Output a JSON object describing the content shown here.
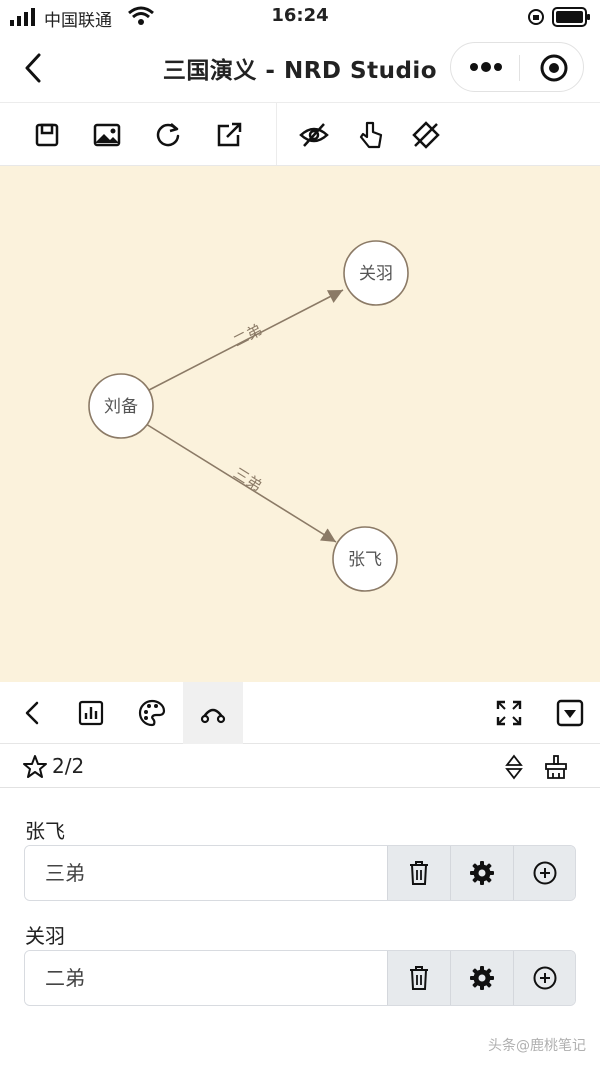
{
  "status_bar": {
    "carrier": "中国联通",
    "time": "16:24"
  },
  "nav": {
    "title": "三国演义 - NRD Studio"
  },
  "toolbar": {
    "left_icons": [
      "save-icon",
      "image-icon",
      "refresh-icon",
      "share-icon"
    ],
    "right_icons": [
      "hide-icon",
      "pointer-icon",
      "crosshair-icon"
    ]
  },
  "graph": {
    "background": "#fbf2dc",
    "nodes": [
      {
        "id": "liubei",
        "label": "刘备"
      },
      {
        "id": "guanyu",
        "label": "关羽"
      },
      {
        "id": "zhangfei",
        "label": "张飞"
      }
    ],
    "edges": [
      {
        "from": "liubei",
        "to": "guanyu",
        "label": "二弟"
      },
      {
        "from": "liubei",
        "to": "zhangfei",
        "label": "三弟"
      }
    ]
  },
  "bottom_bar": {
    "active_tab": "link-tool",
    "icons": [
      "back-icon",
      "chart-icon",
      "palette-icon",
      "link-tool-icon",
      "fullscreen-icon",
      "dropdown-icon"
    ]
  },
  "list_header": {
    "count": "2/2"
  },
  "relations": [
    {
      "name": "张飞",
      "value": "三弟"
    },
    {
      "name": "关羽",
      "value": "二弟"
    }
  ],
  "watermark": "头条@鹿桃笔记"
}
